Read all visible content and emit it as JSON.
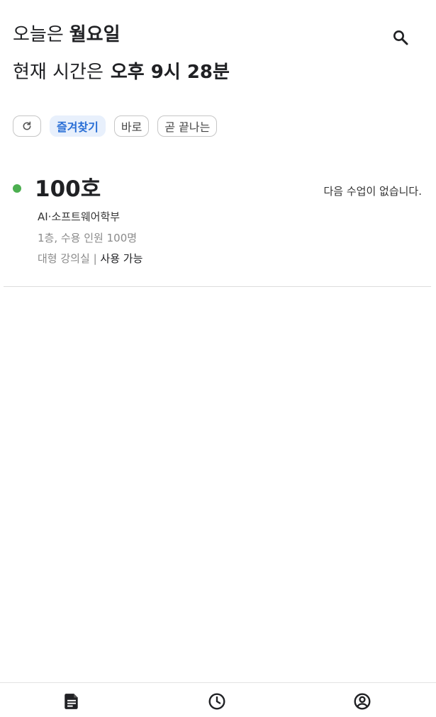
{
  "header": {
    "day_prefix": "오늘은",
    "day_value": "월요일",
    "time_prefix": "현재 시간은",
    "time_value": "오후 9시 28분",
    "search_icon": "search-icon"
  },
  "filters": {
    "refresh_icon": "refresh-icon",
    "chips": [
      {
        "label": "즐겨찾기",
        "active": true
      },
      {
        "label": "바로",
        "active": false
      },
      {
        "label": "곧 끝나는",
        "active": false
      }
    ]
  },
  "rooms": [
    {
      "name": "100호",
      "status_color": "#4caf50",
      "next_class": "다음 수업이 없습니다.",
      "department": "AI·소프트웨어학부",
      "info": "1층, 수용 인원 100명",
      "type": "대형 강의실",
      "separator": "|",
      "status": "사용 가능"
    }
  ],
  "bottom_nav": {
    "items": [
      {
        "icon": "document-icon",
        "selected": true
      },
      {
        "icon": "clock-icon",
        "selected": false
      },
      {
        "icon": "account-circle-icon",
        "selected": false
      }
    ]
  },
  "colors": {
    "accent": "#2a6fd6",
    "accent_bg": "#e8f0fc",
    "available": "#4caf50"
  }
}
